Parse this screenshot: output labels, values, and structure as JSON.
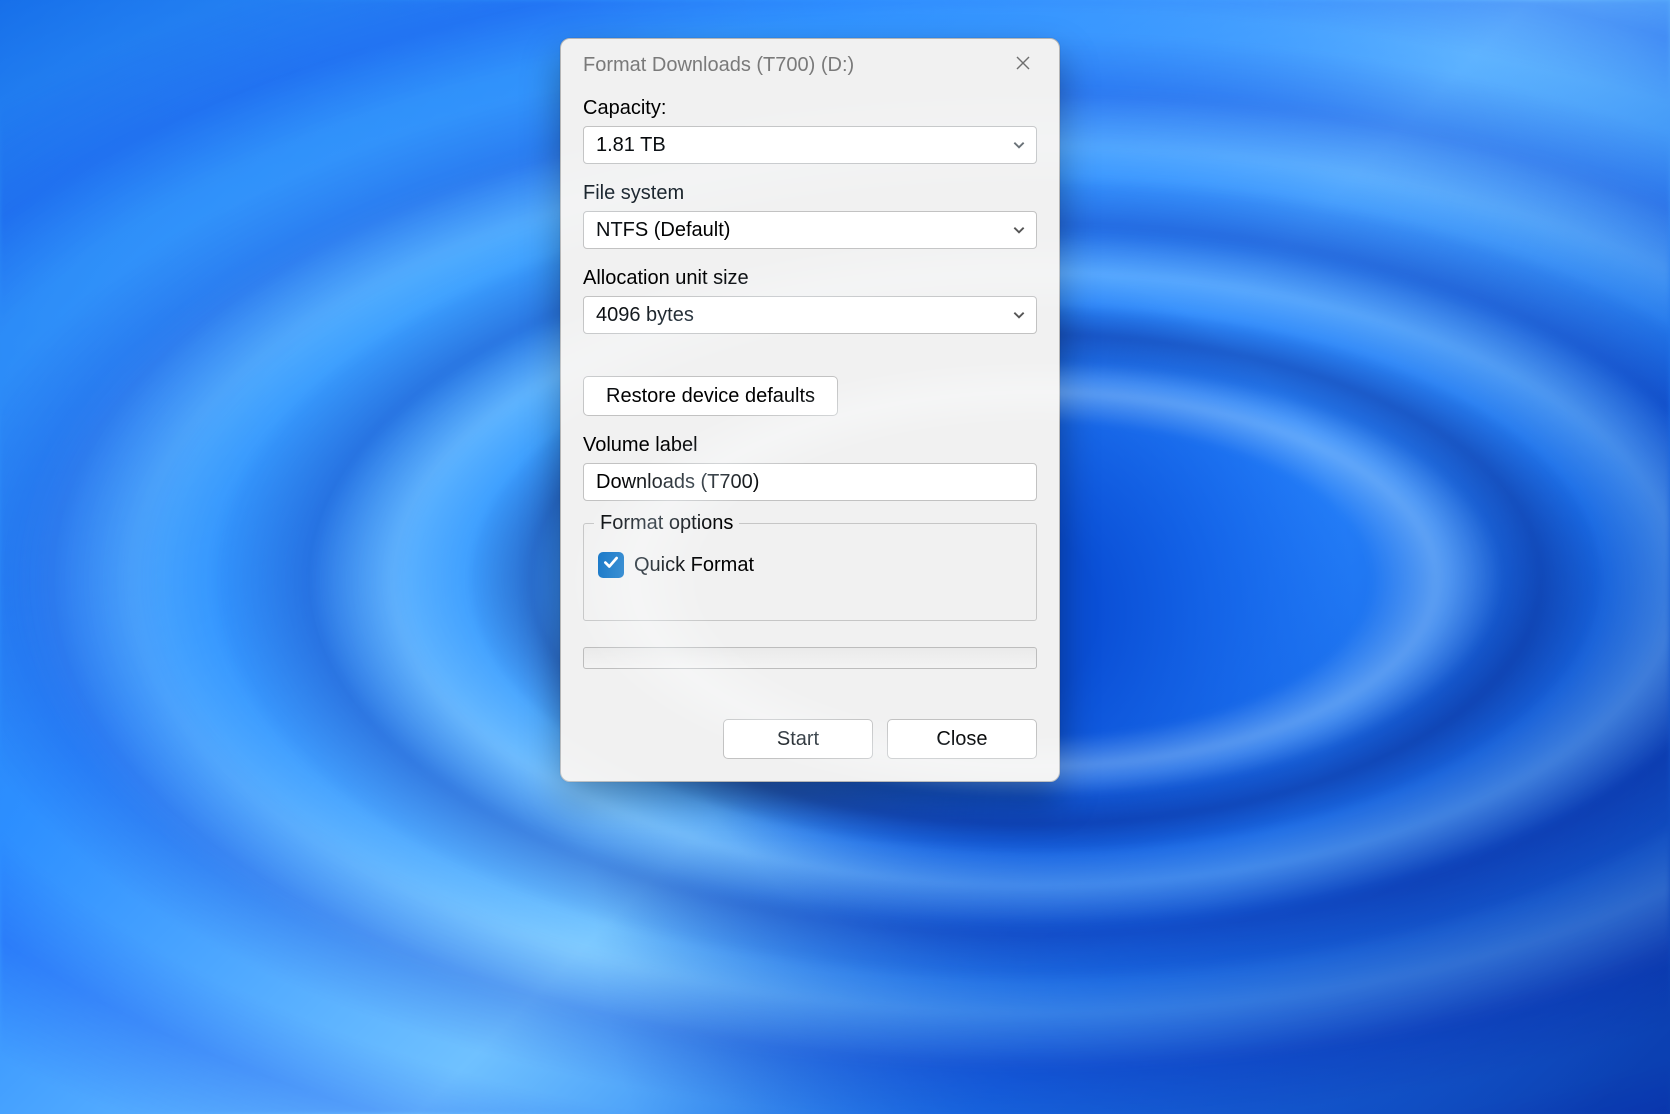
{
  "window": {
    "title": "Format Downloads (T700) (D:)"
  },
  "labels": {
    "capacity": "Capacity:",
    "file_system": "File system",
    "allocation_unit_size": "Allocation unit size",
    "volume_label": "Volume label",
    "format_options": "Format options"
  },
  "values": {
    "capacity": "1.81 TB",
    "file_system": "NTFS (Default)",
    "allocation_unit_size": "4096 bytes",
    "volume_label": "Downloads (T700)"
  },
  "buttons": {
    "restore_defaults": "Restore device defaults",
    "start": "Start",
    "close": "Close"
  },
  "options": {
    "quick_format_label": "Quick Format",
    "quick_format_checked": true
  },
  "colors": {
    "accent": "#0067c0"
  }
}
